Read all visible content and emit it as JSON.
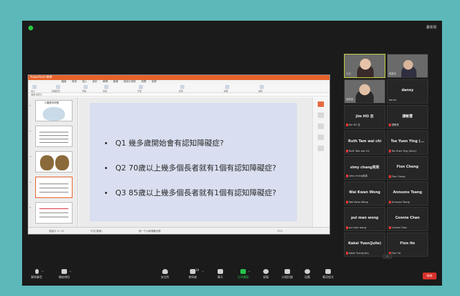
{
  "window": {
    "view_label": "畫檢視"
  },
  "presentation": {
    "app_title": "PowerPoint 教學",
    "menu": [
      "檔案",
      "常用",
      "插入",
      "設計",
      "轉場",
      "動畫",
      "投影片放映",
      "校閱",
      "檢視"
    ],
    "ribbon_labels": [
      "貼上",
      "版面配置",
      "重設",
      "區段",
      "字型",
      "段落",
      "繪圖",
      "編輯"
    ],
    "tab": "檔案 投影片",
    "thumb_title": "人腦退化特徵",
    "questions": [
      "Q1 幾多歲開始會有認知障礙症?",
      "Q2 70歲以上幾多個長者就有1個有認知障礙症?",
      "Q3 85歲以上幾多個長者就有1個有認知障礙症?"
    ],
    "status_left": "投影片 4 / 10",
    "status_mid": "中文(香港)",
    "status_note": "按一下以新增備忘稿",
    "status_zoom": "72%"
  },
  "participants": [
    {
      "name": "",
      "tag": "今日",
      "video": true
    },
    {
      "name": "",
      "tag": "黃麗萍",
      "video": true
    },
    {
      "name": "",
      "tag": "吳曉風",
      "video": true
    },
    {
      "name": "danny",
      "tag": "danny",
      "video": false
    },
    {
      "name": "Jim HO 志",
      "tag": "Jim HO 志",
      "video": false
    },
    {
      "name": "譚敏慧",
      "tag": "譚敏慧",
      "video": false
    },
    {
      "name": "Ruth Tam wai chi",
      "tag": "Ruth Tam wai chi",
      "video": false
    },
    {
      "name": "Tse Yuen Ying (...",
      "tag": "Tse Yuen Ying (Alice)",
      "video": false
    },
    {
      "name": "simy chang英英",
      "tag": "simy chang英英",
      "video": false
    },
    {
      "name": "Fion Cheng",
      "tag": "Fion Cheng",
      "video": false
    },
    {
      "name": "Wai Kwan Wong",
      "tag": "Wai Kwan Wong",
      "video": false
    },
    {
      "name": "Annsons Tsang",
      "tag": "Annsons Tsang",
      "video": false
    },
    {
      "name": "pui man wong",
      "tag": "pui man wong",
      "video": false
    },
    {
      "name": "Connie Chan",
      "tag": "Connie Chan",
      "video": false
    },
    {
      "name": "Kakei Yuen(Julie)",
      "tag": "Kakei Yuen(Julie)",
      "video": false
    },
    {
      "name": "Fion Ho",
      "tag": "Fion Ho",
      "video": false
    }
  ],
  "toolbar": {
    "mute": "解除靜音",
    "video": "開始視訊",
    "security": "安全性",
    "participants": "參與者",
    "participants_count": "19",
    "chat": "聊天",
    "share": "分享畫面",
    "record": "錄製",
    "breakout": "分組討論",
    "reactions": "回應",
    "apps": "應用程式",
    "end": "結束"
  },
  "colors": {
    "accent_green": "#26c34b",
    "end_red": "#d8322b",
    "ppt_orange": "#e7622a"
  }
}
